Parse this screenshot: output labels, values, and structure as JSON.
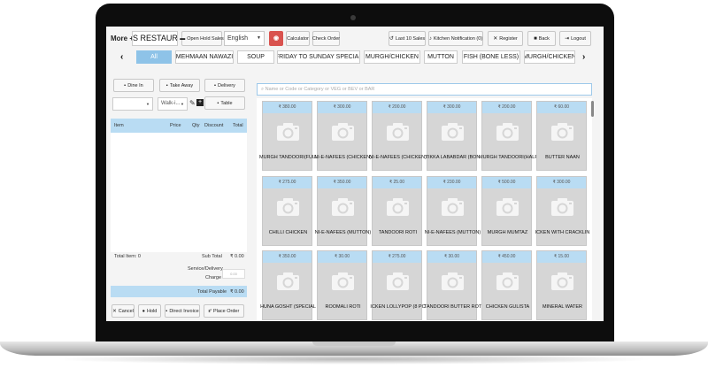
{
  "topbar": {
    "more_label": "More +",
    "restaurant_name": "S RESTAURANT",
    "open_hold_sales": "Open Hold Sales",
    "language": "English",
    "calculator": "Calculator",
    "check_order": "Check Order",
    "last_sales": "Last 10 Sales",
    "kitchen_notification": "Kitchen Notification (0)",
    "register": "Register",
    "back": "Back",
    "logout": "Logout"
  },
  "categories": [
    "All",
    "MEHMAAN NAWAZI",
    "SOUP",
    "FRIDAY TO SUNDAY SPECIAL",
    "MURGH/CHICKEN",
    "MUTTON",
    "FISH (BONE LESS)",
    "MURGH/CHICKEN"
  ],
  "order_types": {
    "dine_in": "Dine In",
    "take_away": "Take Away",
    "delivery": "Delivery"
  },
  "customer": {
    "waiter_value": "",
    "customer_value": "Walk-i...",
    "table_label": "Table"
  },
  "cart": {
    "columns": {
      "item": "Item",
      "price": "Price",
      "qty": "Qty",
      "discount": "Discount",
      "total": "Total"
    },
    "total_item_label": "Total Item: 0",
    "sub_total_label": "Sub Total",
    "sub_total_value": "₹ 0.00",
    "service_charge_label_1": "Service/Delivery",
    "service_charge_label_2": "Charge",
    "service_charge_placeholder": "0.00",
    "total_payable_label": "Total Payable",
    "total_payable_value": "₹ 0.00"
  },
  "actions": {
    "cancel": "Cancel",
    "hold": "Hold",
    "direct_invoice": "Direct Invoice",
    "place_order": "Place Order"
  },
  "search": {
    "placeholder": "Name or Code or Category or VEG or BEV or BAR"
  },
  "products": [
    {
      "price": "₹ 380.00",
      "name": "MURGH TANDOORI(FULL)"
    },
    {
      "price": "₹ 300.00",
      "name": "NI-E-NAFEES (CHICKEN)"
    },
    {
      "price": "₹ 200.00",
      "name": "NI-E-NAFEES (CHICKEN)"
    },
    {
      "price": "₹ 300.00",
      "name": "TIKKA LABABDAR (BON"
    },
    {
      "price": "₹ 200.00",
      "name": "MURGH TANDOORI(HALF)"
    },
    {
      "price": "₹ 60.00",
      "name": "BUTTER NAAN"
    },
    {
      "price": "₹ 275.00",
      "name": "CHILLI CHICKEN"
    },
    {
      "price": "₹ 350.00",
      "name": "NI-E-NAFEES (MUTTON)"
    },
    {
      "price": "₹ 25.00",
      "name": "TANDOORI ROTI"
    },
    {
      "price": "₹ 230.00",
      "name": "NI-E-NAFEES (MUTTON)"
    },
    {
      "price": "₹ 500.00",
      "name": "MURGH MUMTAZ"
    },
    {
      "price": "₹ 300.00",
      "name": "ICKEN WITH CRACKLIN"
    },
    {
      "price": "₹ 350.00",
      "name": "HUNA GOSHT (SPECIAL"
    },
    {
      "price": "₹ 30.00",
      "name": "ROOMALI ROTI"
    },
    {
      "price": "₹ 275.00",
      "name": "ICKEN LOLLYPOP (8 PC"
    },
    {
      "price": "₹ 30.00",
      "name": "TANDOORI BUTTER ROTI"
    },
    {
      "price": "₹ 450.00",
      "name": "CHICKEN GULISTA"
    },
    {
      "price": "₹ 15.00",
      "name": "MINERAL WATER"
    }
  ]
}
